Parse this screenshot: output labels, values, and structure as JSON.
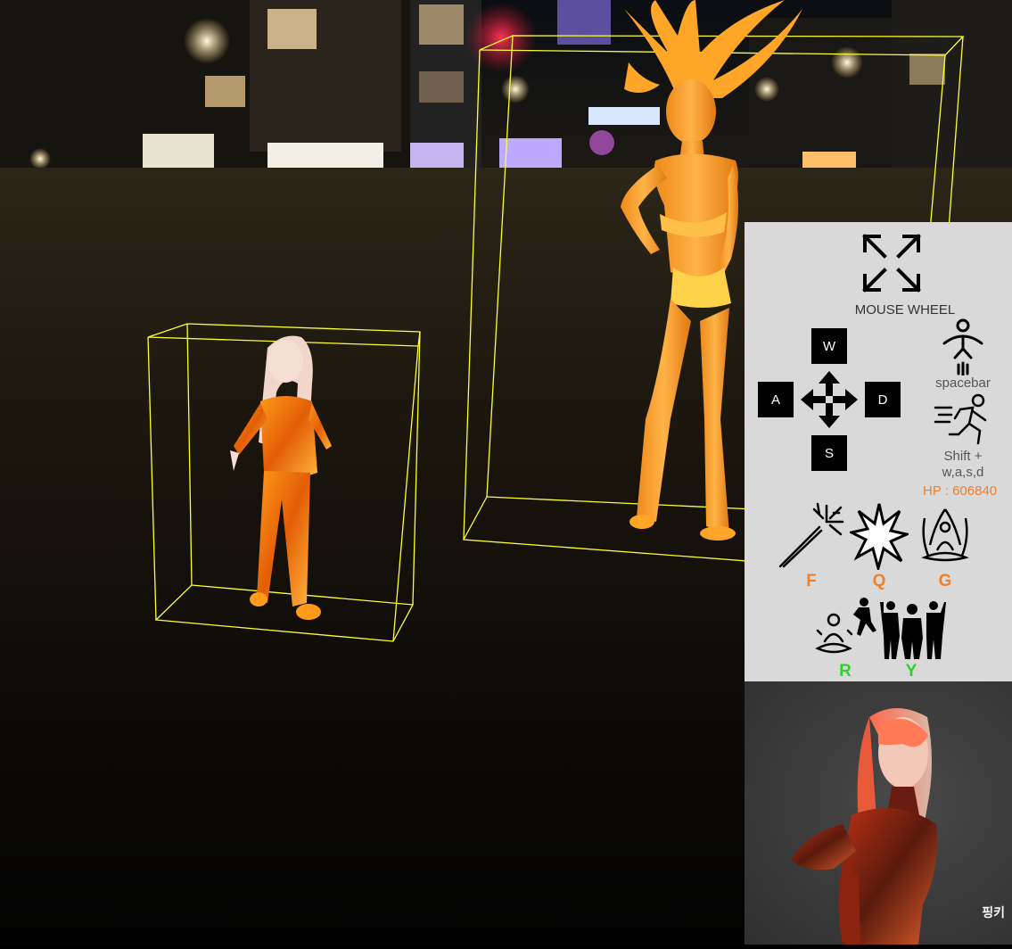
{
  "controls": {
    "zoom_label": "MOUSE WHEEL",
    "keys": {
      "up": "W",
      "left": "A",
      "right": "D",
      "down": "S"
    },
    "jump_label": "spacebar",
    "run_label_line1": "Shift +",
    "run_label_line2": "w,a,s,d",
    "hp_text": "HP : 606840"
  },
  "skills": [
    {
      "key": "F",
      "icon": "sparkler-wand-icon",
      "color": "#f07f2a"
    },
    {
      "key": "Q",
      "icon": "explosion-burst-icon",
      "color": "#f07f2a"
    },
    {
      "key": "G",
      "icon": "meditation-aura-icon",
      "color": "#f07f2a"
    },
    {
      "key": "R",
      "icon": "meditate-dance-icon",
      "color": "#2ed12e"
    },
    {
      "key": "Y",
      "icon": "crowd-cheer-icon",
      "color": "#2ed12e"
    }
  ],
  "character": {
    "name": "핑키"
  },
  "colors": {
    "accent_orange": "#f07f2a",
    "accent_green": "#2ed12e",
    "bounding_box": "#ffff33"
  }
}
